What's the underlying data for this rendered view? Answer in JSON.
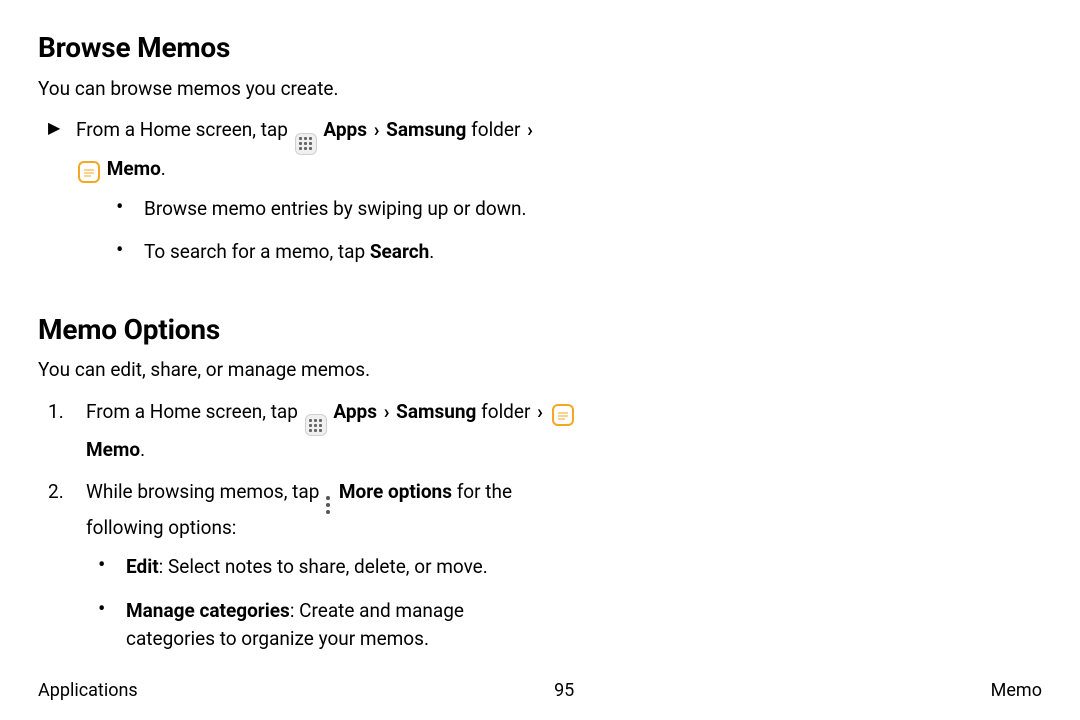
{
  "section1": {
    "title": "Browse Memos",
    "intro": "You can browse memos you create.",
    "path": {
      "lead": "From a Home screen, tap ",
      "apps_label": "Apps",
      "samsung_folder": "Samsung",
      "folder_word": " folder ",
      "memo_label": "Memo",
      "period": "."
    },
    "bullets": [
      {
        "text": "Browse memo entries by swiping up or down."
      },
      {
        "pre": "To search for a memo, tap ",
        "bold": "Search",
        "post": "."
      }
    ]
  },
  "section2": {
    "title": "Memo Options",
    "intro": "You can edit, share, or manage memos.",
    "steps": {
      "step1": {
        "lead": "From a Home screen, tap ",
        "apps_label": "Apps",
        "samsung_folder": "Samsung",
        "folder_word": " folder ",
        "memo_label": "Memo",
        "period": "."
      },
      "step2": {
        "pre": "While browsing memos, tap ",
        "more_label": "More options",
        "post": " for the following options:"
      }
    },
    "sub_bullets": [
      {
        "bold": "Edit",
        "rest": ": Select notes to share, delete, or move."
      },
      {
        "bold": "Manage categories",
        "rest": ": Create and manage categories to organize your memos."
      }
    ]
  },
  "footer": {
    "left": "Applications",
    "center": "95",
    "right": "Memo"
  },
  "glyphs": {
    "chevron": "›",
    "play": "▶"
  }
}
